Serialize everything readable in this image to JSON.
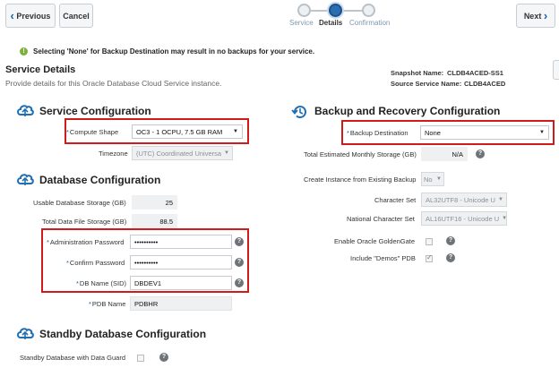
{
  "nav": {
    "previous_label": "Previous",
    "cancel_label": "Cancel",
    "next_label": "Next",
    "steps": [
      {
        "label": "Service",
        "state": "done"
      },
      {
        "label": "Details",
        "state": "active"
      },
      {
        "label": "Confirmation",
        "state": "pending"
      }
    ]
  },
  "warning": {
    "text": "Selecting 'None' for Backup Destination may result in no backups for your service.",
    "icon": "warning-icon"
  },
  "service_details": {
    "title": "Service Details",
    "subtitle": "Provide details for this Oracle Database Cloud Service instance.",
    "snapshot_label": "Snapshot Name:",
    "snapshot_value": "CLDB4ACED-SS1",
    "source_label": "Source Service Name:",
    "source_value": "CLDB4ACED"
  },
  "service_config": {
    "title": "Service Configuration",
    "compute_shape_label": "Compute Shape",
    "compute_shape_value": "OC3 - 1 OCPU, 7.5 GB RAM",
    "timezone_label": "Timezone",
    "timezone_value": "(UTC) Coordinated Universa"
  },
  "db_config": {
    "title": "Database Configuration",
    "usable_storage_label": "Usable Database Storage (GB)",
    "usable_storage_value": "25",
    "total_storage_label": "Total Data File Storage (GB)",
    "total_storage_value": "88.5",
    "admin_password_label": "Administration Password",
    "admin_password_value": "••••••••••",
    "confirm_password_label": "Confirm Password",
    "confirm_password_value": "••••••••••",
    "db_name_label": "DB Name (SID)",
    "db_name_value": "DBDEV1",
    "pdb_name_label": "PDB Name",
    "pdb_name_value": "PDBHR"
  },
  "backup_config": {
    "title": "Backup and Recovery Configuration",
    "backup_destination_label": "Backup Destination",
    "backup_destination_value": "None",
    "monthly_storage_label": "Total Estimated Monthly Storage (GB)",
    "monthly_storage_value": "N/A",
    "create_instance_label": "Create Instance from Existing Backup",
    "create_instance_value": "No",
    "charset_label": "Character Set",
    "charset_value": "AL32UTF8 - Unicode U",
    "ncharset_label": "National Character Set",
    "ncharset_value": "AL16UTF16 - Unicode U",
    "goldengate_label": "Enable Oracle GoldenGate",
    "goldengate_checked": false,
    "demos_label": "Include \"Demos\" PDB",
    "demos_checked": true
  },
  "standby_config": {
    "title": "Standby Database Configuration",
    "dataguard_label": "Standby Database with Data Guard",
    "dataguard_checked": false
  },
  "colors": {
    "highlight": "#d11a1a",
    "accent": "#2a6db0",
    "warning": "#7fb03a"
  }
}
